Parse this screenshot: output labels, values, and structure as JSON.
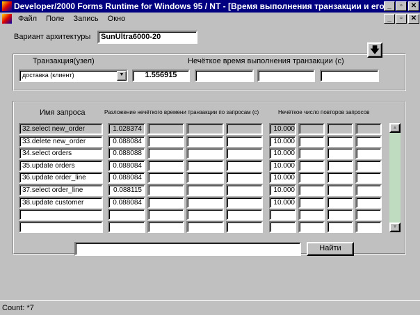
{
  "window": {
    "title": "Developer/2000 Forms Runtime for Windows 95 / NT - [Время выполнения транзакции и его \"..."
  },
  "menu": [
    "Файл",
    "Поле",
    "Запись",
    "Окно"
  ],
  "architecture": {
    "label": "Вариант архитектуры",
    "value": "SunUltra6000-20"
  },
  "transaction": {
    "label": "Транзакция(узел)",
    "selected": "доставка (клиент)",
    "time_label": "Нечёткое время выполнения транзакции (с)",
    "time_values": [
      "1.556915",
      "",
      "",
      ""
    ]
  },
  "queries": {
    "headers": {
      "name": "Имя запроса",
      "decomposition": "Разложение нечёткого времени транзакции по запросам (с)",
      "repeats": "Нечёткое число повторов запросов"
    },
    "rows": [
      {
        "name": "32.select new_order",
        "times": [
          "1.028374",
          "",
          "",
          ""
        ],
        "repeats": [
          "10.000",
          "",
          "",
          ""
        ]
      },
      {
        "name": "33.delete new_order",
        "times": [
          "0.088084",
          "",
          "",
          ""
        ],
        "repeats": [
          "10.000",
          "",
          "",
          ""
        ]
      },
      {
        "name": "34.select orders",
        "times": [
          "0.088088",
          "",
          "",
          ""
        ],
        "repeats": [
          "10.000",
          "",
          "",
          ""
        ]
      },
      {
        "name": "35.update orders",
        "times": [
          "0.088084",
          "",
          "",
          ""
        ],
        "repeats": [
          "10.000",
          "",
          "",
          ""
        ]
      },
      {
        "name": "36.update order_line",
        "times": [
          "0.088084",
          "",
          "",
          ""
        ],
        "repeats": [
          "10.000",
          "",
          "",
          ""
        ]
      },
      {
        "name": "37.select order_line",
        "times": [
          "0.088115",
          "",
          "",
          ""
        ],
        "repeats": [
          "10.000",
          "",
          "",
          ""
        ]
      },
      {
        "name": "38.update customer",
        "times": [
          "0.088084",
          "",
          "",
          ""
        ],
        "repeats": [
          "10.000",
          "",
          "",
          ""
        ]
      },
      {
        "name": "",
        "times": [
          "",
          "",
          "",
          ""
        ],
        "repeats": [
          "",
          "",
          "",
          ""
        ]
      },
      {
        "name": "",
        "times": [
          "",
          "",
          "",
          ""
        ],
        "repeats": [
          "",
          "",
          "",
          ""
        ]
      }
    ]
  },
  "search": {
    "value": "",
    "button": "Найти"
  },
  "status": {
    "text": "Count: *7"
  }
}
